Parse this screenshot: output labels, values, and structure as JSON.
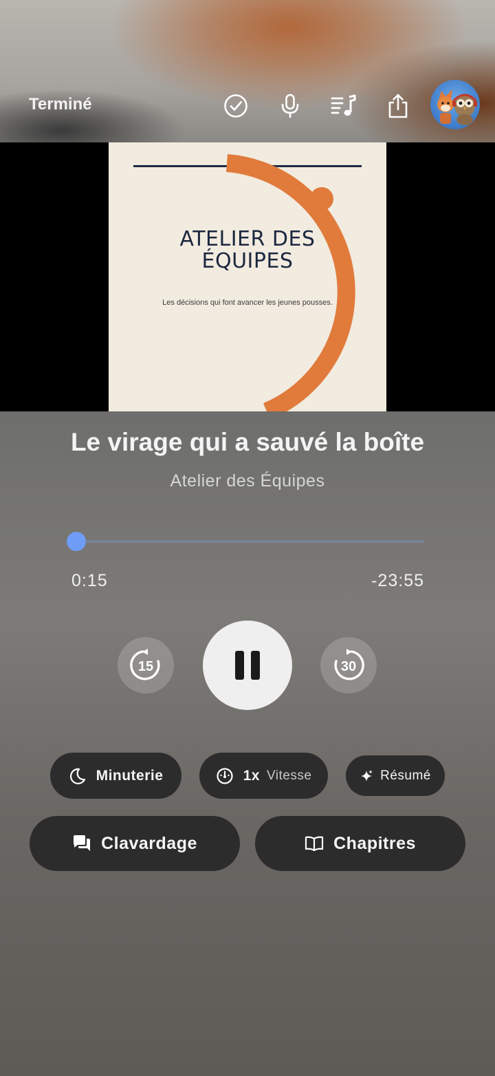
{
  "header": {
    "done_label": "Terminé",
    "icons": [
      "checkmark-circle-icon",
      "microphone-icon",
      "queue-music-icon",
      "share-icon",
      "avatar"
    ]
  },
  "cover": {
    "title_line1": "ATELIER DES",
    "title_line2": "ÉQUIPES",
    "subtitle": "Les décisions qui font avancer les jeunes pousses."
  },
  "episode": {
    "title": "Le virage qui a sauvé la boîte",
    "show": "Atelier des Équipes"
  },
  "player": {
    "elapsed": "0:15",
    "remaining": "-23:55",
    "progress_fraction": 0.0104,
    "skip_back_seconds": "15",
    "skip_forward_seconds": "30",
    "state": "playing"
  },
  "actions": {
    "sleep_timer": "Minuterie",
    "speed_value": "1x",
    "speed_label": "Vitesse",
    "summary": "Résumé",
    "chat": "Clavardage",
    "chapters": "Chapitres"
  },
  "colors": {
    "accent": "#6f9cf5",
    "cover_orange": "#e07b3c",
    "cover_navy": "#1b2740",
    "pill_bg": "#2c2c2d"
  }
}
